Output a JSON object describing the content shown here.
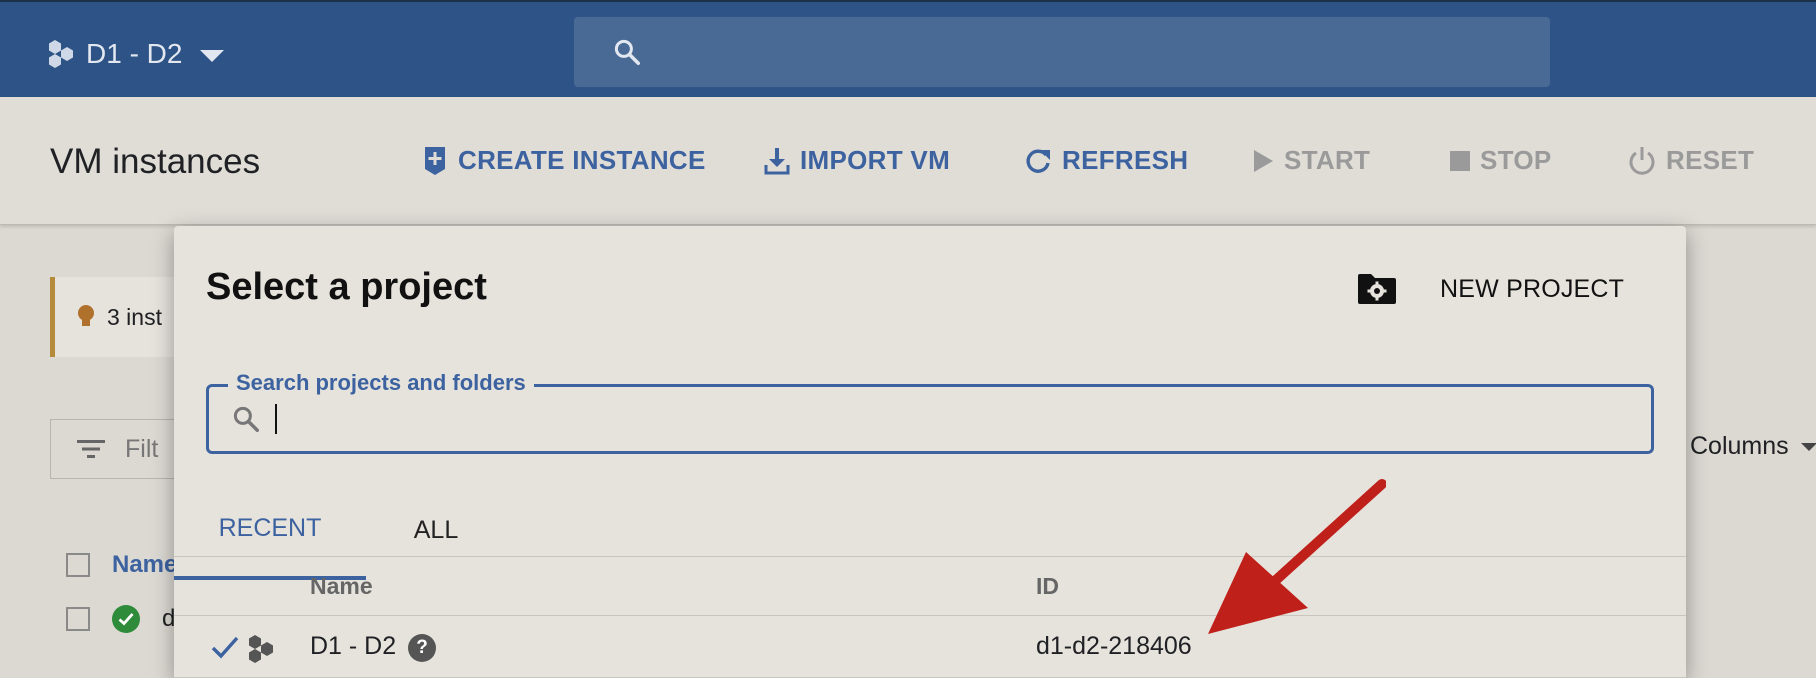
{
  "topbar": {
    "project_name": "D1 - D2"
  },
  "page": {
    "title": "VM instances",
    "actions": [
      {
        "label": "CREATE INSTANCE",
        "enabled": true
      },
      {
        "label": "IMPORT VM",
        "enabled": true
      },
      {
        "label": "REFRESH",
        "enabled": true
      },
      {
        "label": "START",
        "enabled": false
      },
      {
        "label": "STOP",
        "enabled": false
      },
      {
        "label": "RESET",
        "enabled": false
      }
    ],
    "hint_text": "3 inst",
    "filter_text": "Filt",
    "columns_label": "Columns",
    "table_header_name": "Name",
    "row_text": "d"
  },
  "modal": {
    "title": "Select a project",
    "new_project_label": "NEW PROJECT",
    "search_label": "Search projects and folders",
    "search_value": "",
    "tabs": [
      {
        "label": "RECENT",
        "active": true
      },
      {
        "label": "ALL",
        "active": false
      }
    ],
    "columns": {
      "name": "Name",
      "id": "ID"
    },
    "rows": [
      {
        "name": "D1 - D2",
        "id": "d1-d2-218406",
        "selected": true,
        "help": "?"
      }
    ]
  },
  "colors": {
    "topbar": "#2e5386",
    "accent": "#3d62a0",
    "annotation_arrow": "#c0201a"
  }
}
